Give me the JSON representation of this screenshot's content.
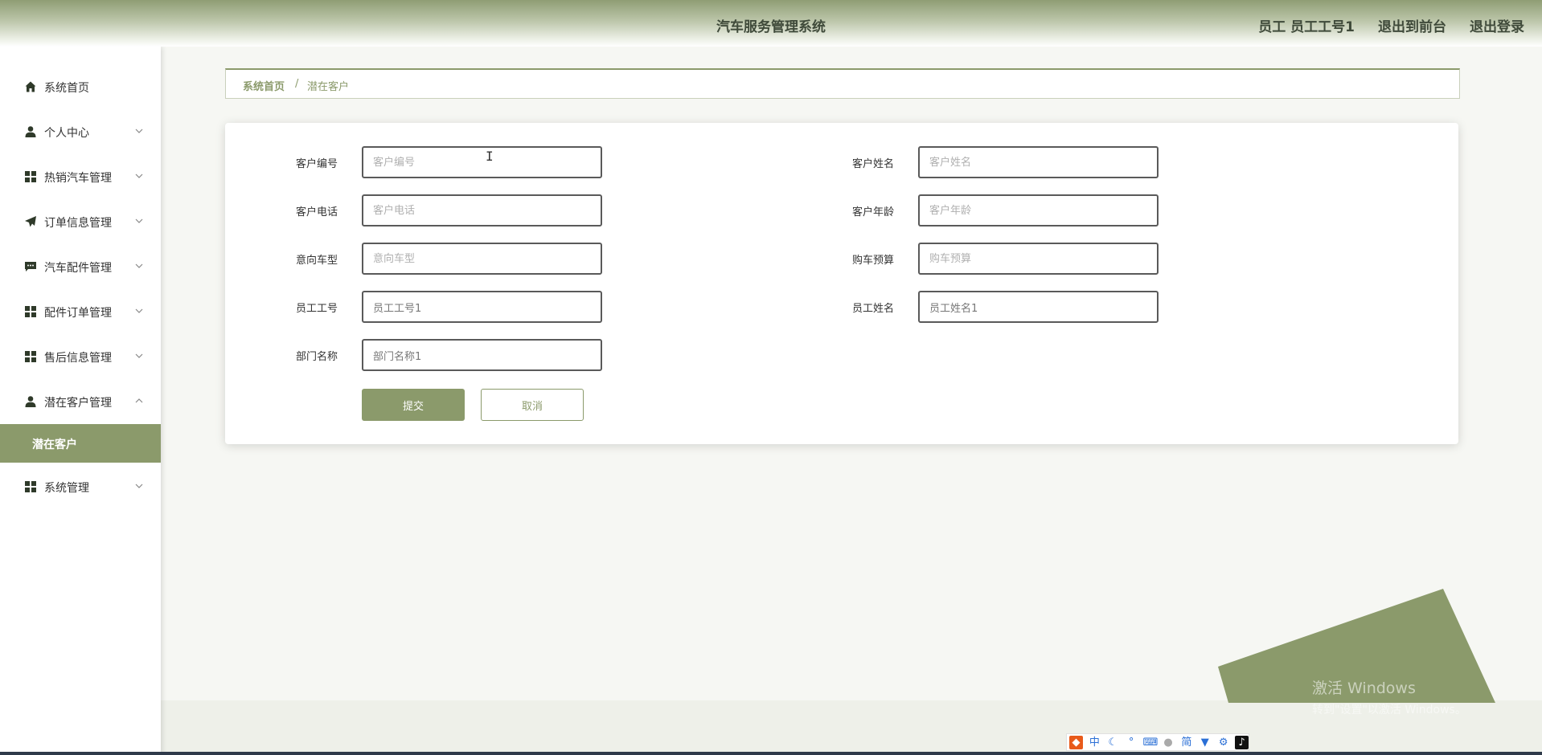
{
  "header": {
    "app_title": "汽车服务管理系统",
    "user_info": "员工 员工工号1",
    "back_to_front": "退出到前台",
    "logout": "退出登录"
  },
  "sidebar": {
    "items": [
      {
        "label": "系统首页",
        "icon": "home-icon",
        "expandable": false
      },
      {
        "label": "个人中心",
        "icon": "user-icon",
        "expandable": true
      },
      {
        "label": "热销汽车管理",
        "icon": "grid-icon",
        "expandable": true
      },
      {
        "label": "订单信息管理",
        "icon": "send-icon",
        "expandable": true
      },
      {
        "label": "汽车配件管理",
        "icon": "message-icon",
        "expandable": true
      },
      {
        "label": "配件订单管理",
        "icon": "grid-icon",
        "expandable": true
      },
      {
        "label": "售后信息管理",
        "icon": "grid-icon",
        "expandable": true
      },
      {
        "label": "潜在客户管理",
        "icon": "user-icon",
        "expandable": true,
        "expanded": true
      },
      {
        "label": "系统管理",
        "icon": "grid-icon",
        "expandable": true
      }
    ],
    "active_submenu": "潜在客户"
  },
  "breadcrumb": {
    "home": "系统首页",
    "separator": "/",
    "current": "潜在客户"
  },
  "form": {
    "fields": [
      {
        "label": "客户编号",
        "value": "",
        "placeholder": "客户编号"
      },
      {
        "label": "客户姓名",
        "value": "",
        "placeholder": "客户姓名"
      },
      {
        "label": "客户电话",
        "value": "",
        "placeholder": "客户电话"
      },
      {
        "label": "客户年龄",
        "value": "",
        "placeholder": "客户年龄"
      },
      {
        "label": "意向车型",
        "value": "",
        "placeholder": "意向车型"
      },
      {
        "label": "购车预算",
        "value": "",
        "placeholder": "购车预算"
      },
      {
        "label": "员工工号",
        "value": "员工工号1",
        "placeholder": "员工工号"
      },
      {
        "label": "员工姓名",
        "value": "员工姓名1",
        "placeholder": "员工姓名"
      },
      {
        "label": "部门名称",
        "value": "部门名称1",
        "placeholder": "部门名称"
      }
    ],
    "submit_label": "提交",
    "cancel_label": "取消"
  },
  "watermark": {
    "line1": "激活 Windows",
    "line2": "转到\"设置\"以激活 Windows。"
  },
  "tray": [
    "中",
    "简"
  ],
  "colors": {
    "accent": "#8b9a6b",
    "header_text": "#3f4a3a"
  }
}
